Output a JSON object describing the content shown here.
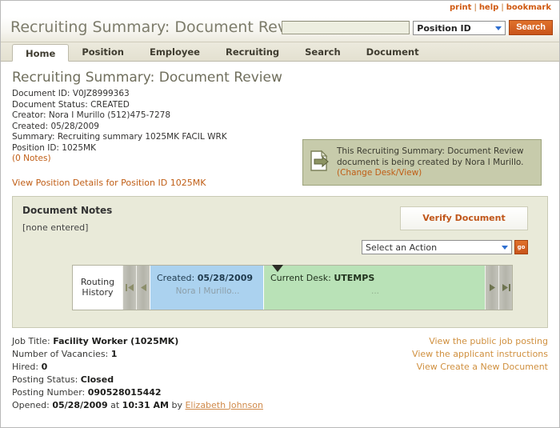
{
  "utility": {
    "links": [
      {
        "label": "print",
        "name": "print-link"
      },
      {
        "label": "help",
        "name": "help-link"
      },
      {
        "label": "bookmark",
        "name": "bookmark-link"
      }
    ],
    "separator": "|"
  },
  "header": {
    "app_title": "Recruiting Summary: Document Review",
    "search": {
      "value": "",
      "placeholder": "",
      "scope_selected": "Position ID",
      "button_label": "Search"
    }
  },
  "tabs": [
    {
      "label": "Home",
      "active": true
    },
    {
      "label": "Position",
      "active": false
    },
    {
      "label": "Employee",
      "active": false
    },
    {
      "label": "Recruiting",
      "active": false
    },
    {
      "label": "Search",
      "active": false
    },
    {
      "label": "Document",
      "active": false
    }
  ],
  "document": {
    "title": "Recruiting Summary: Document Review",
    "meta": [
      {
        "label": "Document ID:",
        "value": "V0JZ8999363"
      },
      {
        "label": "Document Status:",
        "value": "CREATED"
      },
      {
        "label": "Creator:",
        "value": "Nora I Murillo (512)475-7278"
      },
      {
        "label": "Created:",
        "value": "05/28/2009"
      },
      {
        "label": "Summary:",
        "value": "Recruiting summary 1025MK FACIL WRK"
      },
      {
        "label": "Position ID:",
        "value": "1025MK"
      }
    ],
    "notes_count": "(0 Notes)",
    "position_details_link": "View Position Details for Position ID 1025MK"
  },
  "notification": {
    "line1": "This Recruiting Summary: Document Review",
    "line2": "document is being created by Nora I Murillo.",
    "link": "(Change Desk/View)"
  },
  "notes_panel": {
    "title": "Document Notes",
    "empty_text": "[none entered]",
    "verify_button": "Verify Document",
    "action_select": "Select an Action",
    "go_button": "go"
  },
  "routing": {
    "label_line1": "Routing",
    "label_line2": "History",
    "steps": [
      {
        "label": "Created:",
        "value": "05/28/2009",
        "sub": "Nora I Murillo..."
      },
      {
        "label": "Current Desk:",
        "value": "UTEMPS",
        "sub": "..."
      }
    ],
    "nav": {
      "first": "first-page",
      "prev": "previous",
      "next": "next",
      "last": "last-page"
    }
  },
  "job": {
    "fields": [
      {
        "label": "Job Title:",
        "value": "Facility Worker (1025MK)"
      },
      {
        "label": "Number of Vacancies:",
        "value": "1"
      },
      {
        "label": "Hired:",
        "value": "0"
      },
      {
        "label": "Posting Status:",
        "value": "Closed"
      },
      {
        "label": "Posting Number:",
        "value": "090528015442"
      }
    ],
    "opened_label": "Opened:",
    "opened_date": "05/28/2009",
    "opened_at": "at",
    "opened_time": "10:31 AM",
    "opened_by": "by",
    "opened_person": "Elizabeth Johnson"
  },
  "footer_links": [
    "View the public job posting",
    "View the applicant instructions",
    "View Create a New Document"
  ],
  "colors": {
    "accent_orange": "#c9541a",
    "link_orange": "#c05e16",
    "panel_cream": "#e9ead9",
    "notify_sage": "#c7cbab",
    "step_blue": "#abd2ef",
    "step_green": "#b9e2b7"
  }
}
